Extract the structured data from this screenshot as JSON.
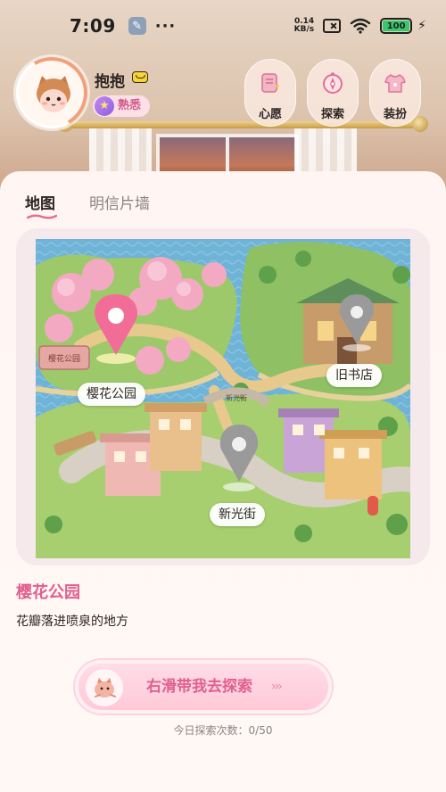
{
  "status_bar": {
    "time": "7:09",
    "net_speed_value": "0.14",
    "net_speed_unit": "KB/s",
    "battery": "100"
  },
  "profile": {
    "username": "抱抱",
    "level": "熟悉"
  },
  "top_buttons": [
    {
      "label": "心愿",
      "icon": "wish-list-icon"
    },
    {
      "label": "探索",
      "icon": "compass-icon"
    },
    {
      "label": "装扮",
      "icon": "outfit-icon"
    }
  ],
  "tabs": [
    {
      "label": "地图",
      "active": true
    },
    {
      "label": "明信片墙",
      "active": false
    }
  ],
  "map": {
    "locations": [
      {
        "name": "樱花公园",
        "selected": true
      },
      {
        "name": "旧书店",
        "selected": false
      },
      {
        "name": "新光街",
        "selected": false
      }
    ],
    "signs": {
      "park_gate": "樱花公园",
      "street_arch": "新光街",
      "bookshop": "旧书店"
    }
  },
  "selected_place": {
    "name": "樱花公园",
    "description": "花瓣落进喷泉的地方"
  },
  "action": {
    "slide_label": "右滑带我去探索",
    "arrows": "›››",
    "daily_count": "今日探索次数：0/50"
  },
  "colors": {
    "accent_pink": "#e0608e",
    "battery_green": "#38c76a",
    "sheet_bg": "#fff6f3"
  }
}
